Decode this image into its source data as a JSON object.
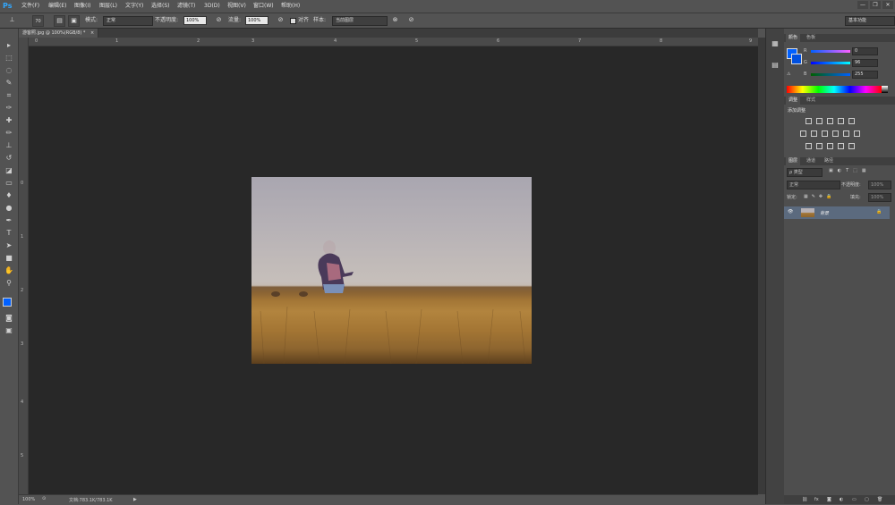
{
  "app": {
    "logo": "Ps"
  },
  "menubar": {
    "items": [
      "文件(F)",
      "编辑(E)",
      "图像(I)",
      "图层(L)",
      "文字(Y)",
      "选择(S)",
      "滤镜(T)",
      "3D(D)",
      "视图(V)",
      "窗口(W)",
      "帮助(H)"
    ]
  },
  "window_controls": [
    "—",
    "❐",
    "✕"
  ],
  "options": {
    "brush_size": "70",
    "mode_label": "模式:",
    "mode_value": "正常",
    "opacity_label": "不透明度:",
    "opacity_value": "100%",
    "flow_label": "流量:",
    "flow_value": "100%",
    "aligned_label": "对齐",
    "sample_label": "样本:",
    "sample_value": "当前图层",
    "workspace": "基本功能"
  },
  "document": {
    "tab_title": "游客照.jpg @ 100%(RGB/8) *",
    "close": "×",
    "ruler_top_ticks": [
      "0",
      "1",
      "2",
      "3",
      "4",
      "5",
      "6",
      "7",
      "8",
      "9"
    ],
    "ruler_left_ticks": [
      "0",
      "1",
      "2",
      "3",
      "4",
      "5"
    ]
  },
  "statusbar": {
    "zoom": "100%",
    "doc_info": "文档:783.1K/783.1K"
  },
  "color_panel": {
    "tabs": [
      "颜色",
      "色板"
    ],
    "channels": [
      {
        "name": "R",
        "value": "0"
      },
      {
        "name": "G",
        "value": "96"
      },
      {
        "name": "B",
        "value": "255"
      }
    ],
    "foreground": "#0060ff"
  },
  "adjust_panel": {
    "tabs": [
      "调整",
      "样式"
    ],
    "title": "添加调整"
  },
  "layers_panel": {
    "tabs": [
      "图层",
      "通道",
      "路径"
    ],
    "filter_label": "ρ 类型",
    "blend_mode": "正常",
    "opacity_label": "不透明度:",
    "opacity_value": "100%",
    "lock_label": "锁定:",
    "fill_label": "填充:",
    "fill_value": "100%",
    "layers": [
      {
        "name": "背景",
        "visible": true,
        "locked": true
      }
    ]
  },
  "colors": {
    "accent": "#31a8ff",
    "ui_bg": "#535353",
    "canvas_bg": "#282828",
    "selected_layer": "#5b6a7e"
  }
}
